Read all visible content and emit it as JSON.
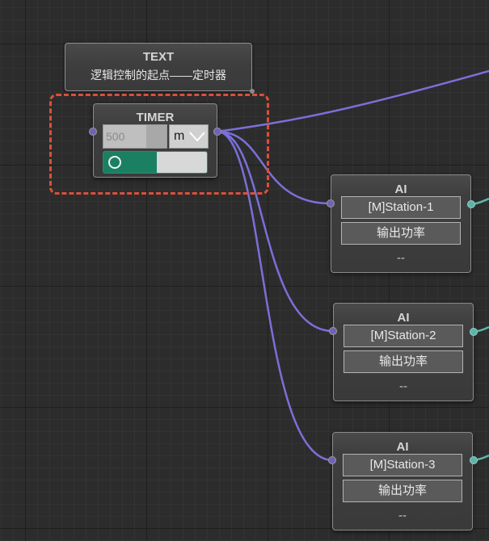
{
  "canvas": {
    "wire_color": "#7b6fd9",
    "out_wire_color": "#5fb4a8",
    "selection_color": "#d9503a"
  },
  "text_node": {
    "title": "TEXT",
    "content": "逻辑控制的起点——定时器"
  },
  "timer_node": {
    "title": "TIMER",
    "interval_value": "500",
    "unit": "m",
    "toggle_state": "on",
    "toggle_on_color": "#1a8061"
  },
  "ai_nodes": [
    {
      "title": "AI",
      "station": "[M]Station-1",
      "metric": "输出功率",
      "value": "--"
    },
    {
      "title": "AI",
      "station": "[M]Station-2",
      "metric": "输出功率",
      "value": "--"
    },
    {
      "title": "AI",
      "station": "[M]Station-3",
      "metric": "输出功率",
      "value": "--"
    }
  ]
}
